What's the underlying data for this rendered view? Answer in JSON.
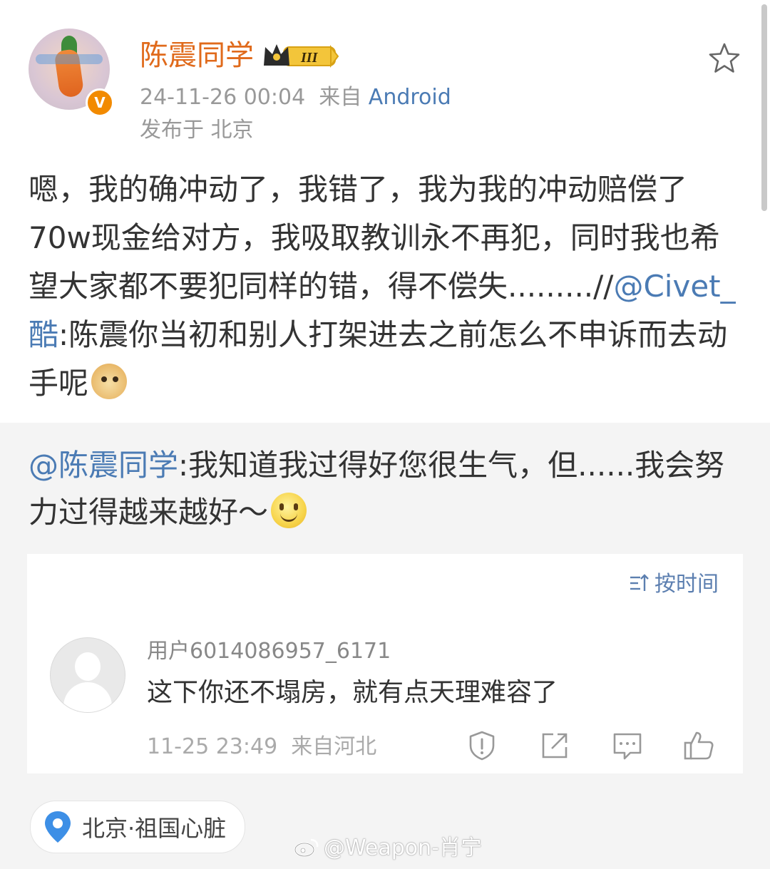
{
  "post": {
    "author_name": "陈震同学",
    "vip_level": "III",
    "verified_badge": "V",
    "timestamp": "24-11-26 00:04",
    "source_prefix": "来自",
    "source_app": "Android",
    "location": "发布于 北京",
    "body_text": "嗯，我的确冲动了，我错了，我为我的冲动赔偿了70w现金给对方，我吸取教训永不再犯，同时我也希望大家都不要犯同样的错，得不偿失.........//",
    "repost_mention": "@Civet_酷",
    "repost_text": ":陈震你当初和别人打架进去之前怎么不申诉而去动手呢",
    "repost_emoji": "doge-emoji"
  },
  "quoted": {
    "mention": "@陈震同学",
    "text": ":我知道我过得好您很生气，但......我会努力过得越来越好～",
    "emoji": "smile-emoji"
  },
  "comments": {
    "sort_label": "按时间",
    "items": [
      {
        "user": "用户6014086957_6171",
        "text": "这下你还不塌房，就有点天理难容了",
        "time": "11-25 23:49",
        "source": "来自河北"
      }
    ]
  },
  "location_chip": {
    "label": "北京·祖国心脏"
  },
  "watermark": {
    "text": "@Weapon-肖宁"
  },
  "icons": [
    "star-icon",
    "verified-badge-icon",
    "vip-crown-icon",
    "sort-icon",
    "report-icon",
    "share-icon",
    "comment-icon",
    "like-icon",
    "location-pin-icon",
    "weibo-logo-icon"
  ],
  "colors": {
    "author_name": "#e06a1b",
    "link": "#4b7bb4",
    "meta": "#999999",
    "quote_bg": "#f4f4f4",
    "location_pin": "#3d8fe6"
  }
}
